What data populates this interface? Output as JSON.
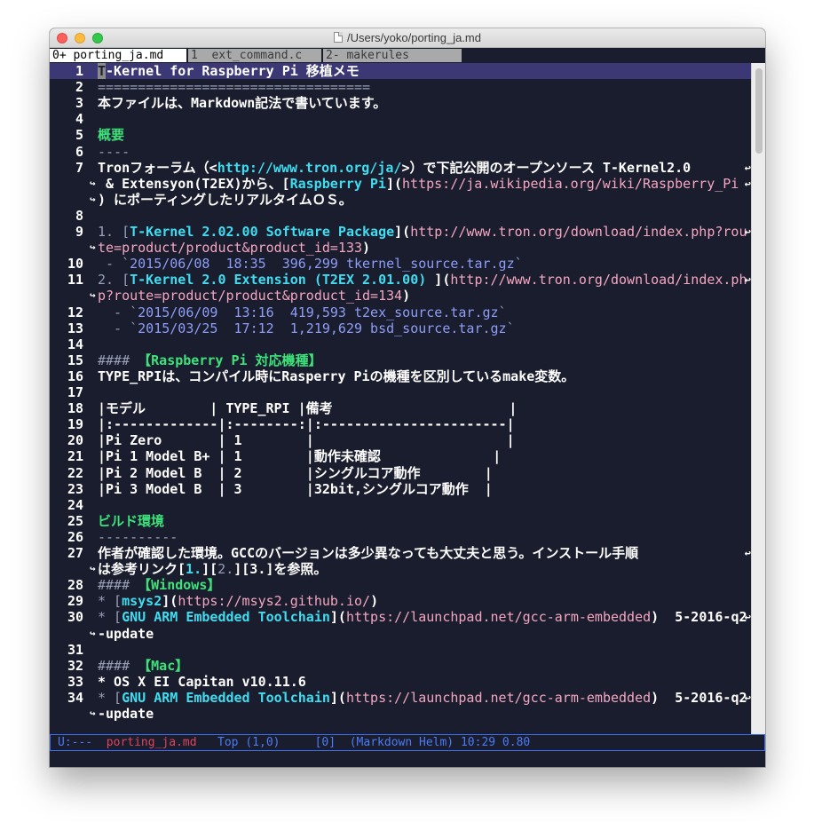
{
  "window": {
    "title": "/Users/yoko/porting_ja.md"
  },
  "tabs": [
    {
      "label": "0+ porting_ja.md"
    },
    {
      "label": "1  ext_command.c"
    },
    {
      "label": "2- makerules"
    }
  ],
  "lines": [
    {
      "num": "1",
      "segments": [
        {
          "t": "T",
          "c": "cursor"
        },
        {
          "t": "-Kernel for Raspberry Pi 移植メモ"
        }
      ]
    },
    {
      "num": "2",
      "segments": [
        {
          "t": "==================================",
          "c": "c-dim"
        }
      ]
    },
    {
      "num": "3",
      "segments": [
        {
          "t": "本ファイルは、Markdown記法で書いています。"
        }
      ]
    },
    {
      "num": "4",
      "segments": []
    },
    {
      "num": "5",
      "segments": [
        {
          "t": "概要",
          "c": "c-green"
        }
      ]
    },
    {
      "num": "6",
      "segments": [
        {
          "t": "----",
          "c": "c-dim"
        }
      ]
    },
    {
      "num": "7",
      "segments": [
        {
          "t": "Tronフォーラム（<"
        },
        {
          "t": "http://www.tron.org/ja/",
          "c": "c-cyan"
        },
        {
          "t": ">）で下記公開のオープンソース T-Kernel2.0"
        }
      ],
      "cont": true
    },
    {
      "num": "",
      "segments": [
        {
          "t": " & Extensyon(T2EX)から、["
        },
        {
          "t": "Raspberry Pi",
          "c": "c-cyan"
        },
        {
          "t": "]("
        },
        {
          "t": "https://ja.wikipedia.org/wiki/Raspberry_Pi",
          "c": "c-pink"
        }
      ],
      "cont": true,
      "contLeft": true
    },
    {
      "num": "",
      "segments": [
        {
          "t": ") にポーティングしたリアルタイムＯＳ。"
        }
      ],
      "contLeft": true
    },
    {
      "num": "8",
      "segments": []
    },
    {
      "num": "9",
      "segments": [
        {
          "t": "1. [",
          "c": "c-dim"
        },
        {
          "t": "T-Kernel 2.02.00 Software Package",
          "c": "c-cyan"
        },
        {
          "t": "]("
        },
        {
          "t": "http://www.tron.org/download/index.php?rou",
          "c": "c-pink"
        }
      ],
      "cont": true
    },
    {
      "num": "",
      "segments": [
        {
          "t": "te=product/product&product_id=133",
          "c": "c-pink"
        },
        {
          "t": ")"
        }
      ],
      "contLeft": true
    },
    {
      "num": "10",
      "segments": [
        {
          "t": " - `",
          "c": "c-dim"
        },
        {
          "t": "2015/06/08  18:35  396,299 tkernel_source.tar.gz",
          "c": "c-blue"
        },
        {
          "t": "`",
          "c": "c-dim"
        }
      ]
    },
    {
      "num": "11",
      "segments": [
        {
          "t": "2. [",
          "c": "c-dim"
        },
        {
          "t": "T-Kernel 2.0 Extension (T2EX 2.01.00) ",
          "c": "c-cyan"
        },
        {
          "t": "]("
        },
        {
          "t": "http://www.tron.org/download/index.ph",
          "c": "c-pink"
        }
      ],
      "cont": true
    },
    {
      "num": "",
      "segments": [
        {
          "t": "p?route=product/product&product_id=134",
          "c": "c-pink"
        },
        {
          "t": ")"
        }
      ],
      "contLeft": true
    },
    {
      "num": "12",
      "segments": [
        {
          "t": "  - `",
          "c": "c-dim"
        },
        {
          "t": "2015/06/09  13:16  419,593 t2ex_source.tar.gz",
          "c": "c-blue"
        },
        {
          "t": "`",
          "c": "c-dim"
        }
      ]
    },
    {
      "num": "13",
      "segments": [
        {
          "t": "  - `",
          "c": "c-dim"
        },
        {
          "t": "2015/03/25  17:12  1,219,629 bsd_source.tar.gz",
          "c": "c-blue"
        },
        {
          "t": "`",
          "c": "c-dim"
        }
      ]
    },
    {
      "num": "14",
      "segments": []
    },
    {
      "num": "15",
      "segments": [
        {
          "t": "#### ",
          "c": "c-dim"
        },
        {
          "t": "【Raspberry Pi 対応機種】",
          "c": "c-green"
        }
      ]
    },
    {
      "num": "16",
      "segments": [
        {
          "t": "TYPE_RPIは、コンパイル時にRasperry Piの機種を区別しているmake変数。"
        }
      ]
    },
    {
      "num": "17",
      "segments": []
    },
    {
      "num": "18",
      "segments": [
        {
          "t": "|モデル        | TYPE_RPI |備考                      |"
        }
      ]
    },
    {
      "num": "19",
      "segments": [
        {
          "t": "|:-------------|:--------:|:-----------------------|"
        }
      ]
    },
    {
      "num": "20",
      "segments": [
        {
          "t": "|Pi Zero       | 1        |                        |"
        }
      ]
    },
    {
      "num": "21",
      "segments": [
        {
          "t": "|Pi 1 Model B+ | 1        |動作未確認              |"
        }
      ]
    },
    {
      "num": "22",
      "segments": [
        {
          "t": "|Pi 2 Model B  | 2        |シングルコア動作        |"
        }
      ]
    },
    {
      "num": "23",
      "segments": [
        {
          "t": "|Pi 3 Model B  | 3        |32bit,シングルコア動作  |"
        }
      ]
    },
    {
      "num": "24",
      "segments": []
    },
    {
      "num": "25",
      "segments": [
        {
          "t": "ビルド環境",
          "c": "c-green"
        }
      ]
    },
    {
      "num": "26",
      "segments": [
        {
          "t": "----------",
          "c": "c-dim"
        }
      ]
    },
    {
      "num": "27",
      "segments": [
        {
          "t": "作者が確認した環境。GCCのバージョンは多少異なっても大丈夫と思う。インストール手順"
        }
      ],
      "cont": true
    },
    {
      "num": "",
      "segments": [
        {
          "t": "は参考リンク["
        },
        {
          "t": "1.",
          "c": "c-cyan"
        },
        {
          "t": "]["
        },
        {
          "t": "2.",
          "c": "c-dim"
        },
        {
          "t": "][3.]を参照。"
        }
      ],
      "contLeft": true
    },
    {
      "num": "28",
      "segments": [
        {
          "t": "#### ",
          "c": "c-dim"
        },
        {
          "t": "【Windows】",
          "c": "c-green"
        }
      ]
    },
    {
      "num": "29",
      "segments": [
        {
          "t": "* [",
          "c": "c-dim"
        },
        {
          "t": "msys2",
          "c": "c-cyan"
        },
        {
          "t": "]("
        },
        {
          "t": "https://msys2.github.io/",
          "c": "c-pink"
        },
        {
          "t": ")"
        }
      ]
    },
    {
      "num": "30",
      "segments": [
        {
          "t": "* [",
          "c": "c-dim"
        },
        {
          "t": "GNU ARM Embedded Toolchain",
          "c": "c-cyan"
        },
        {
          "t": "]("
        },
        {
          "t": "https://launchpad.net/gcc-arm-embedded",
          "c": "c-pink"
        },
        {
          "t": ")  5-2016-q2"
        }
      ],
      "cont": true
    },
    {
      "num": "",
      "segments": [
        {
          "t": "-update"
        }
      ],
      "contLeft": true
    },
    {
      "num": "31",
      "segments": []
    },
    {
      "num": "32",
      "segments": [
        {
          "t": "#### ",
          "c": "c-dim"
        },
        {
          "t": "【Mac】",
          "c": "c-green"
        }
      ]
    },
    {
      "num": "33",
      "segments": [
        {
          "t": "* OS X EI Capitan v10.11.6"
        }
      ]
    },
    {
      "num": "34",
      "segments": [
        {
          "t": "* [",
          "c": "c-dim"
        },
        {
          "t": "GNU ARM Embedded Toolchain",
          "c": "c-cyan"
        },
        {
          "t": "]("
        },
        {
          "t": "https://launchpad.net/gcc-arm-embedded",
          "c": "c-pink"
        },
        {
          "t": ")  5-2016-q2"
        }
      ],
      "cont": true
    },
    {
      "num": "",
      "segments": [
        {
          "t": "-update"
        }
      ],
      "contLeft": true
    }
  ],
  "glyphs": {
    "wrap_right": "↩",
    "wrap_left": "↪"
  },
  "modeline": {
    "state": "U:---  ",
    "buffer": "porting_ja.md",
    "rest": "   Top (1,0)     [0]  (Markdown Helm) 10:29 0.80"
  }
}
